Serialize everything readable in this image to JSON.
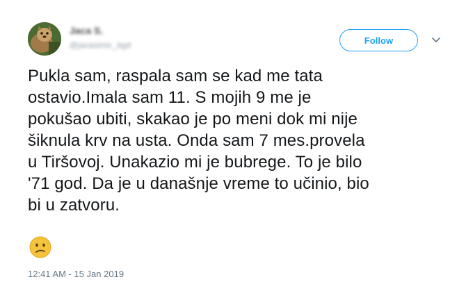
{
  "tweet": {
    "display_name": "Jaca S.",
    "handle": "@jacasimic_bgd",
    "follow_label": "Follow",
    "text": "Pukla sam, raspala sam se kad me tata\nostavio.Imala sam 11. S mojih 9 me je\npokušao ubiti, skakao je po meni dok mi nije\nšiknula krv na usta. Onda sam 7 mes.provela\nu Tiršovoj. Unakazio mi je bubrege. To je bilo\n'71 god. Da je u današnje vreme to učinio, bio\nbi u zatvoru.",
    "emoji": "confused-face-emoji",
    "timestamp": "12:41 AM - 15 Jan 2019"
  },
  "colors": {
    "accent": "#1da1f2",
    "text": "#14171a",
    "muted": "#657786",
    "emoji_face": "#f5c33b"
  }
}
